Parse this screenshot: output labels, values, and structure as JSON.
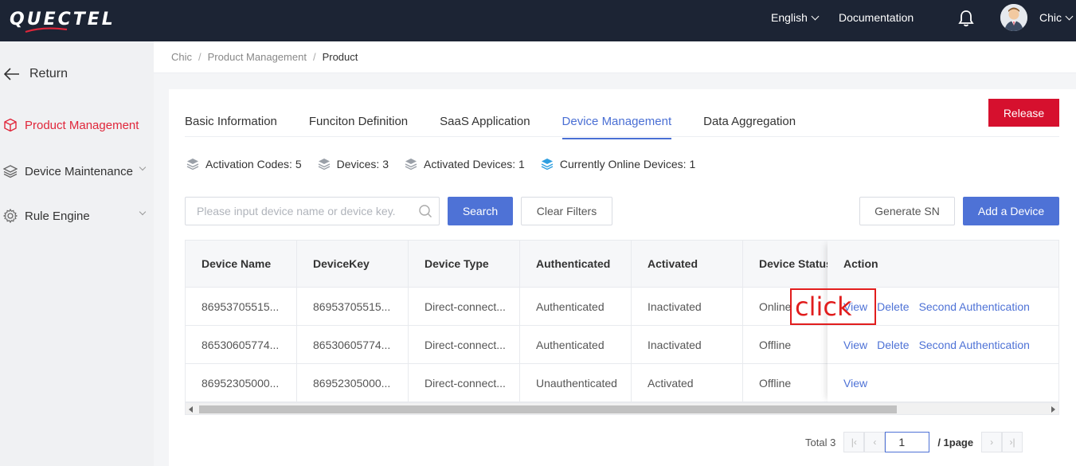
{
  "topbar": {
    "logo_text": "QUECTEL",
    "language": "English",
    "documentation": "Documentation",
    "user": "Chic"
  },
  "sidebar": {
    "return_label": "Return",
    "items": [
      {
        "label": "Product Management",
        "icon": "cube-icon",
        "active": true
      },
      {
        "label": "Device Maintenance",
        "icon": "layers-icon",
        "expandable": true
      },
      {
        "label": "Rule Engine",
        "icon": "gear-icon",
        "expandable": true
      }
    ]
  },
  "breadcrumb": [
    "Chic",
    "Product Management",
    "Product"
  ],
  "tabs": [
    "Basic Information",
    "Funciton Definition",
    "SaaS Application",
    "Device Management",
    "Data Aggregation"
  ],
  "active_tab": "Device Management",
  "release_label": "Release",
  "stats": [
    {
      "label": "Activation Codes: 5"
    },
    {
      "label": "Devices: 3"
    },
    {
      "label": "Activated Devices: 1"
    },
    {
      "label": "Currently Online Devices: 1"
    }
  ],
  "search": {
    "placeholder": "Please input device name or device key.",
    "search_label": "Search",
    "clear_label": "Clear Filters"
  },
  "actions": {
    "generate_sn": "Generate SN",
    "add_device": "Add a Device"
  },
  "table": {
    "columns": [
      "Device Name",
      "DeviceKey",
      "Device Type",
      "Authenticated",
      "Activated",
      "Device Status",
      "Action"
    ],
    "rows": [
      {
        "name": "86953705515...",
        "key": "86953705515...",
        "type": "Direct-connect...",
        "auth": "Authenticated",
        "activated": "Inactivated",
        "status": "Online",
        "actions": [
          "View",
          "Delete",
          "Second Authentication"
        ]
      },
      {
        "name": "86530605774...",
        "key": "86530605774...",
        "type": "Direct-connect...",
        "auth": "Authenticated",
        "activated": "Inactivated",
        "status": "Offline",
        "actions": [
          "View",
          "Delete",
          "Second Authentication"
        ]
      },
      {
        "name": "86952305000...",
        "key": "86952305000...",
        "type": "Direct-connect...",
        "auth": "Unauthenticated",
        "activated": "Activated",
        "status": "Offline",
        "actions": [
          "View"
        ]
      }
    ]
  },
  "annotation": "click",
  "pager": {
    "total": "Total 3",
    "current": "1",
    "pages": "/ 1page"
  },
  "colors": {
    "topbar": "#1c2434",
    "accent": "#4e72d6",
    "brand_red": "#d6102e",
    "online": "#2ac24a"
  }
}
